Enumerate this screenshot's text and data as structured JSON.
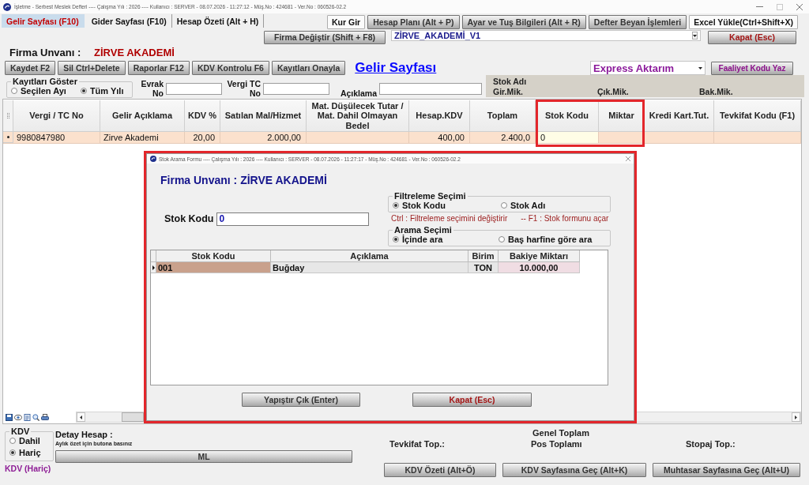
{
  "window": {
    "title": "İşletme - Serbest Meslek Defteri ---- Çalışma Yılı : 2026 ---- Kullanıcı : SERVER - 08.07.2026 - 11:27:12 - Müş.No : 424681 - Ver.No : 060526-02.2"
  },
  "tabs": [
    {
      "label": "Gelir Sayfası (F10)",
      "selected": true
    },
    {
      "label": "Gider Sayfası (F10)",
      "selected": false
    },
    {
      "label": "Hesap Özeti (Alt + H)",
      "selected": false
    }
  ],
  "top_buttons": [
    {
      "label": "Kur Gir",
      "kind": "flat"
    },
    {
      "label": "Hesap Planı (Alt + P)",
      "kind": "raised"
    },
    {
      "label": "Ayar ve Tuş Bilgileri (Alt + R)",
      "kind": "raised"
    },
    {
      "label": "Defter Beyan İşlemleri",
      "kind": "raised"
    },
    {
      "label": "Excel Yükle(Ctrl+Shift+X)",
      "kind": "flat"
    }
  ],
  "company_switch": {
    "button": "Firma Değiştir (Shift + F8)",
    "database": "ZİRVE_AKADEMİ_V1",
    "close_button": "Kapat (Esc)"
  },
  "company": {
    "label": "Firma Unvanı :",
    "name": "ZİRVE AKADEMİ"
  },
  "actions": [
    "Kaydet F2",
    "Sil Ctrl+Delete",
    "Raporlar F12",
    "KDV Kontrolu F6",
    "Kayıtları Onayla"
  ],
  "page_title": "Gelir Sayfası",
  "transfer": {
    "value": "Express Aktarım",
    "button": "Faaliyet Kodu Yaz"
  },
  "show_records": {
    "title": "Kayıtları Göster",
    "options": [
      {
        "label": "Seçilen Ayı",
        "selected": false
      },
      {
        "label": "Tüm Yılı",
        "selected": true
      }
    ]
  },
  "filters": [
    {
      "label": "Evrak No"
    },
    {
      "label": "Vergi TC No"
    },
    {
      "label": "Açıklama"
    }
  ],
  "stock_info": {
    "name_label": "Stok Adı",
    "labels": [
      "Gir.Mik.",
      "Çık.Mik.",
      "Bak.Mik."
    ]
  },
  "table": {
    "columns": [
      {
        "label": "Vergi / TC No",
        "kind": "text",
        "highlighted": false
      },
      {
        "label": "Gelir Açıklama",
        "kind": "text",
        "highlighted": false
      },
      {
        "label": "KDV %",
        "kind": "number",
        "highlighted": false
      },
      {
        "label": "Satılan Mal/Hizmet",
        "kind": "number",
        "highlighted": false
      },
      {
        "label": "Mat. Düşülecek Tutar / Mat. Dahil Olmayan Bedel",
        "kind": "number",
        "highlighted": false
      },
      {
        "label": "Hesap.KDV",
        "kind": "number",
        "highlighted": false
      },
      {
        "label": "Toplam",
        "kind": "number",
        "highlighted": false
      },
      {
        "label": "Stok Kodu",
        "kind": "input",
        "highlighted": true
      },
      {
        "label": "Miktar",
        "kind": "number",
        "highlighted": true
      },
      {
        "label": "Kredi Kart.Tut.",
        "kind": "number",
        "highlighted": false
      },
      {
        "label": "Tevkifat Kodu (F1)",
        "kind": "text",
        "highlighted": false
      }
    ],
    "rows": [
      {
        "selected": true,
        "cells": [
          "9980847980",
          "Zirve Akademi",
          "20,00",
          "2.000,00",
          null,
          "400,00",
          "2.400,0",
          "0",
          null,
          null,
          null
        ]
      }
    ]
  },
  "bottom": {
    "kdv": {
      "title": "KDV",
      "options": [
        {
          "label": "Dahil",
          "selected": false
        },
        {
          "label": "Hariç",
          "selected": true
        }
      ],
      "status": "KDV (Hariç)"
    },
    "detail": {
      "title": "Detay Hesap :",
      "hint": "Aylık özet için butona basınız",
      "button": "ML"
    },
    "totals": {
      "general": "Genel Toplam",
      "withholding": "Tevkifat Top.:",
      "pos": "Pos Toplamı",
      "stoppage": "Stopaj Top.:"
    },
    "buttons": [
      "KDV Özeti (Alt+Ö)",
      "KDV Sayfasına Geç (Alt+K)",
      "Muhtasar Sayfasına Geç (Alt+U)"
    ]
  },
  "dialog": {
    "title": "Stok Arama Formu ---- Çalışma Yılı : 2026 ---- Kullanıcı : SERVER - 08.07.2026 - 11:27:17 - Müş.No : 424681 - Ver.No : 060526-02.2",
    "highlighted": true,
    "company": "Firma Unvanı : ZİRVE AKADEMİ",
    "search": {
      "label": "Stok Kodu",
      "value": "0"
    },
    "filter": {
      "title": "Filtreleme Seçimi",
      "options": [
        {
          "label": "Stok Kodu",
          "selected": true
        },
        {
          "label": "Stok Adı",
          "selected": false
        }
      ]
    },
    "hints": [
      "Ctrl : Filtreleme seçimini değiştirir",
      "-- F1 : Stok formunu açar"
    ],
    "mode": {
      "title": "Arama Seçimi",
      "options": [
        {
          "label": "İçinde ara",
          "selected": true
        },
        {
          "label": "Baş harfine göre ara",
          "selected": false
        }
      ]
    },
    "table": {
      "columns": [
        {
          "label": "Stok Kodu",
          "kind": "code"
        },
        {
          "label": "Açıklama",
          "kind": "text"
        },
        {
          "label": "Birim",
          "kind": "unit"
        },
        {
          "label": "Bakiye Miktarı",
          "kind": "amount"
        }
      ],
      "rows": [
        {
          "selected": true,
          "cells": [
            "001",
            "Buğday",
            "TON",
            "10.000,00"
          ]
        }
      ]
    },
    "buttons": [
      {
        "label": "Yapıştır Çık (Enter)",
        "kind": "raised"
      },
      {
        "label": "Kapat (Esc)",
        "kind": "close"
      }
    ]
  }
}
